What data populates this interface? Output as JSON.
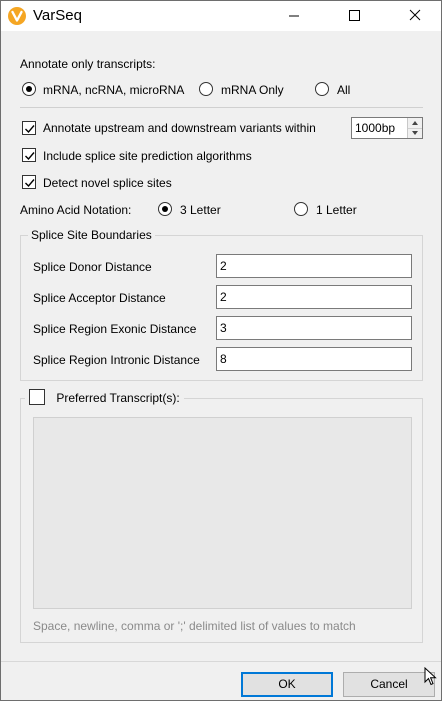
{
  "window": {
    "title": "VarSeq",
    "icon": "varseq-logo-icon",
    "accent_color": "#f5a623",
    "controls": [
      "minimize-icon",
      "maximize-icon",
      "close-icon"
    ]
  },
  "annotate_only": {
    "label": "Annotate only transcripts:",
    "options": [
      {
        "label": "mRNA, ncRNA, microRNA",
        "checked": true
      },
      {
        "label": "mRNA Only",
        "checked": false
      },
      {
        "label": "All",
        "checked": false
      }
    ]
  },
  "checkboxes": {
    "upstream_downstream": {
      "label": "Annotate upstream and downstream variants within",
      "checked": true
    },
    "splice_prediction": {
      "label": "Include splice site prediction algorithms",
      "checked": true
    },
    "novel_splice": {
      "label": "Detect novel splice sites",
      "checked": true
    }
  },
  "distance_spin": {
    "value": "1000bp"
  },
  "amino_acid": {
    "label": "Amino Acid Notation:",
    "options": [
      {
        "label": "3 Letter",
        "checked": true
      },
      {
        "label": "1 Letter",
        "checked": false
      }
    ]
  },
  "splice_boundaries": {
    "title": "Splice Site Boundaries",
    "fields": [
      {
        "label": "Splice Donor Distance",
        "value": "2"
      },
      {
        "label": "Splice Acceptor Distance",
        "value": "2"
      },
      {
        "label": "Splice Region Exonic Distance",
        "value": "3"
      },
      {
        "label": "Splice Region Intronic Distance",
        "value": "8"
      }
    ]
  },
  "preferred_transcripts": {
    "label": "Preferred Transcript(s):",
    "checked": false,
    "value": "",
    "hint": "Space, newline, comma or ';' delimited list of values to match"
  },
  "footer": {
    "ok_label": "OK",
    "cancel_label": "Cancel",
    "ok_border_color": "#0078d7"
  }
}
